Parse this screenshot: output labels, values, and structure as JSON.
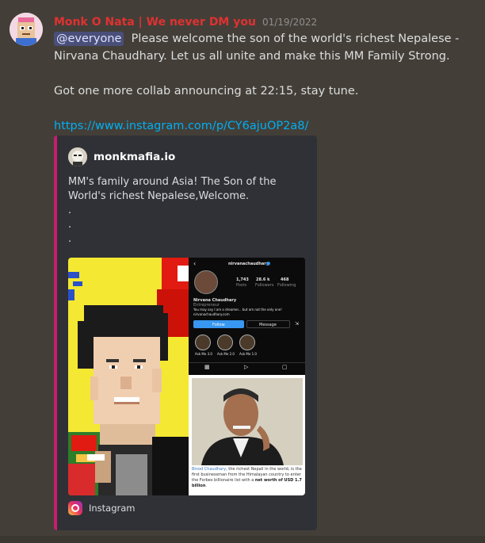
{
  "message": {
    "author": "Monk O Nata | We never DM you",
    "timestamp": "01/19/2022",
    "mention": "@everyone",
    "line1": "Please welcome the son of the world's richest Nepalese - Nirvana Chaudhary. Let us all unite and make this MM Family Strong.",
    "line2": "Got one more collab announcing at 22:15, stay tune.",
    "link": "https://www.instagram.com/p/CY6ajuOP2a8/"
  },
  "embed": {
    "author": "monkmafia.io",
    "description": "MM's family around Asia! The Son of the World's richest Nepalese,Welcome.",
    "dots": [
      ".",
      ".",
      "."
    ],
    "footer": "Instagram",
    "accent_color": "#c81e6e",
    "footer_icon": "instagram-icon",
    "screenshot": {
      "username": "nirvanachaudhary",
      "posts_count": "1,743",
      "posts_label": "Posts",
      "followers_count": "28.6 k",
      "followers_label": "Followers",
      "following_count": "468",
      "following_label": "Following",
      "name": "Nirvana Chaudhary",
      "role": "Entrepreneur",
      "bio": "You may say I am a dreamer... but am not the only one!",
      "website": "nirvanachaudhary.com",
      "follow_label": "Follow",
      "message_label": "Message",
      "highlights": [
        "Ask Me 3.0",
        "Ask Me 2.0",
        "Ask Me 1.0"
      ],
      "news": {
        "name": "Binod Chaudhary",
        "text1": ", the richest Nepali in the world, is the first businessman from the Himalayan country to enter the Forbes billionaire list with a ",
        "bold": "net worth of USD 1.7 billion",
        "text2": "."
      }
    }
  }
}
